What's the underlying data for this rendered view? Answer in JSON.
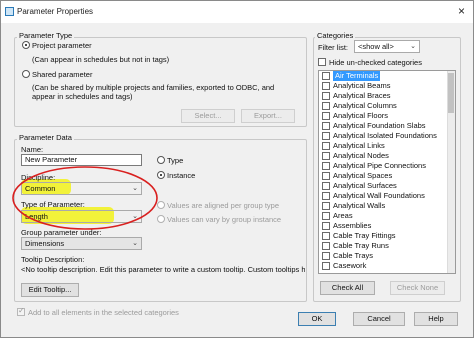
{
  "window": {
    "title": "Parameter Properties",
    "close": "×"
  },
  "parameter_type": {
    "group_label": "Parameter Type",
    "project_label": "Project parameter",
    "project_desc": "(Can appear in schedules but not in tags)",
    "shared_label": "Shared parameter",
    "shared_desc_1": "(Can be shared by multiple projects and families, exported to ODBC, and",
    "shared_desc_2": "appear in schedules and tags)",
    "select_button": "Select...",
    "export_button": "Export..."
  },
  "parameter_data": {
    "group_label": "Parameter Data",
    "name_label": "Name:",
    "name_value": "New Parameter",
    "type_radio": "Type",
    "instance_radio": "Instance",
    "discipline_label": "Discipline:",
    "discipline_value": "Common",
    "type_of_param_label": "Type of Parameter:",
    "type_of_param_value": "Length",
    "values_aligned": "Values are aligned per group type",
    "values_vary": "Values can vary by group instance",
    "group_under_label": "Group parameter under:",
    "group_under_value": "Dimensions",
    "tooltip_label": "Tooltip Description:",
    "tooltip_value": "<No tooltip description. Edit this parameter to write a custom tooltip. Custom tooltips hav...",
    "edit_tooltip_button": "Edit Tooltip..."
  },
  "add_all_label": "Add to all elements in the selected categories",
  "categories": {
    "group_label": "Categories",
    "filter_label": "Filter list:",
    "filter_value": "<show all>",
    "hide_unchecked": "Hide un-checked categories",
    "items": [
      {
        "label": "Air Terminals",
        "selected": true
      },
      {
        "label": "Analytical Beams"
      },
      {
        "label": "Analytical Braces"
      },
      {
        "label": "Analytical Columns"
      },
      {
        "label": "Analytical Floors"
      },
      {
        "label": "Analytical Foundation Slabs"
      },
      {
        "label": "Analytical Isolated Foundations"
      },
      {
        "label": "Analytical Links"
      },
      {
        "label": "Analytical Nodes"
      },
      {
        "label": "Analytical Pipe Connections"
      },
      {
        "label": "Analytical Spaces"
      },
      {
        "label": "Analytical Surfaces"
      },
      {
        "label": "Analytical Wall Foundations"
      },
      {
        "label": "Analytical Walls"
      },
      {
        "label": "Areas"
      },
      {
        "label": "Assemblies"
      },
      {
        "label": "Cable Tray Fittings"
      },
      {
        "label": "Cable Tray Runs"
      },
      {
        "label": "Cable Trays"
      },
      {
        "label": "Casework"
      }
    ],
    "check_all_button": "Check All",
    "check_none_button": "Check None"
  },
  "footer": {
    "ok": "OK",
    "cancel": "Cancel",
    "help": "Help"
  },
  "colors": {
    "highlight": "#f2f23a",
    "annotation": "#d9201f",
    "selection": "#3399ff"
  }
}
